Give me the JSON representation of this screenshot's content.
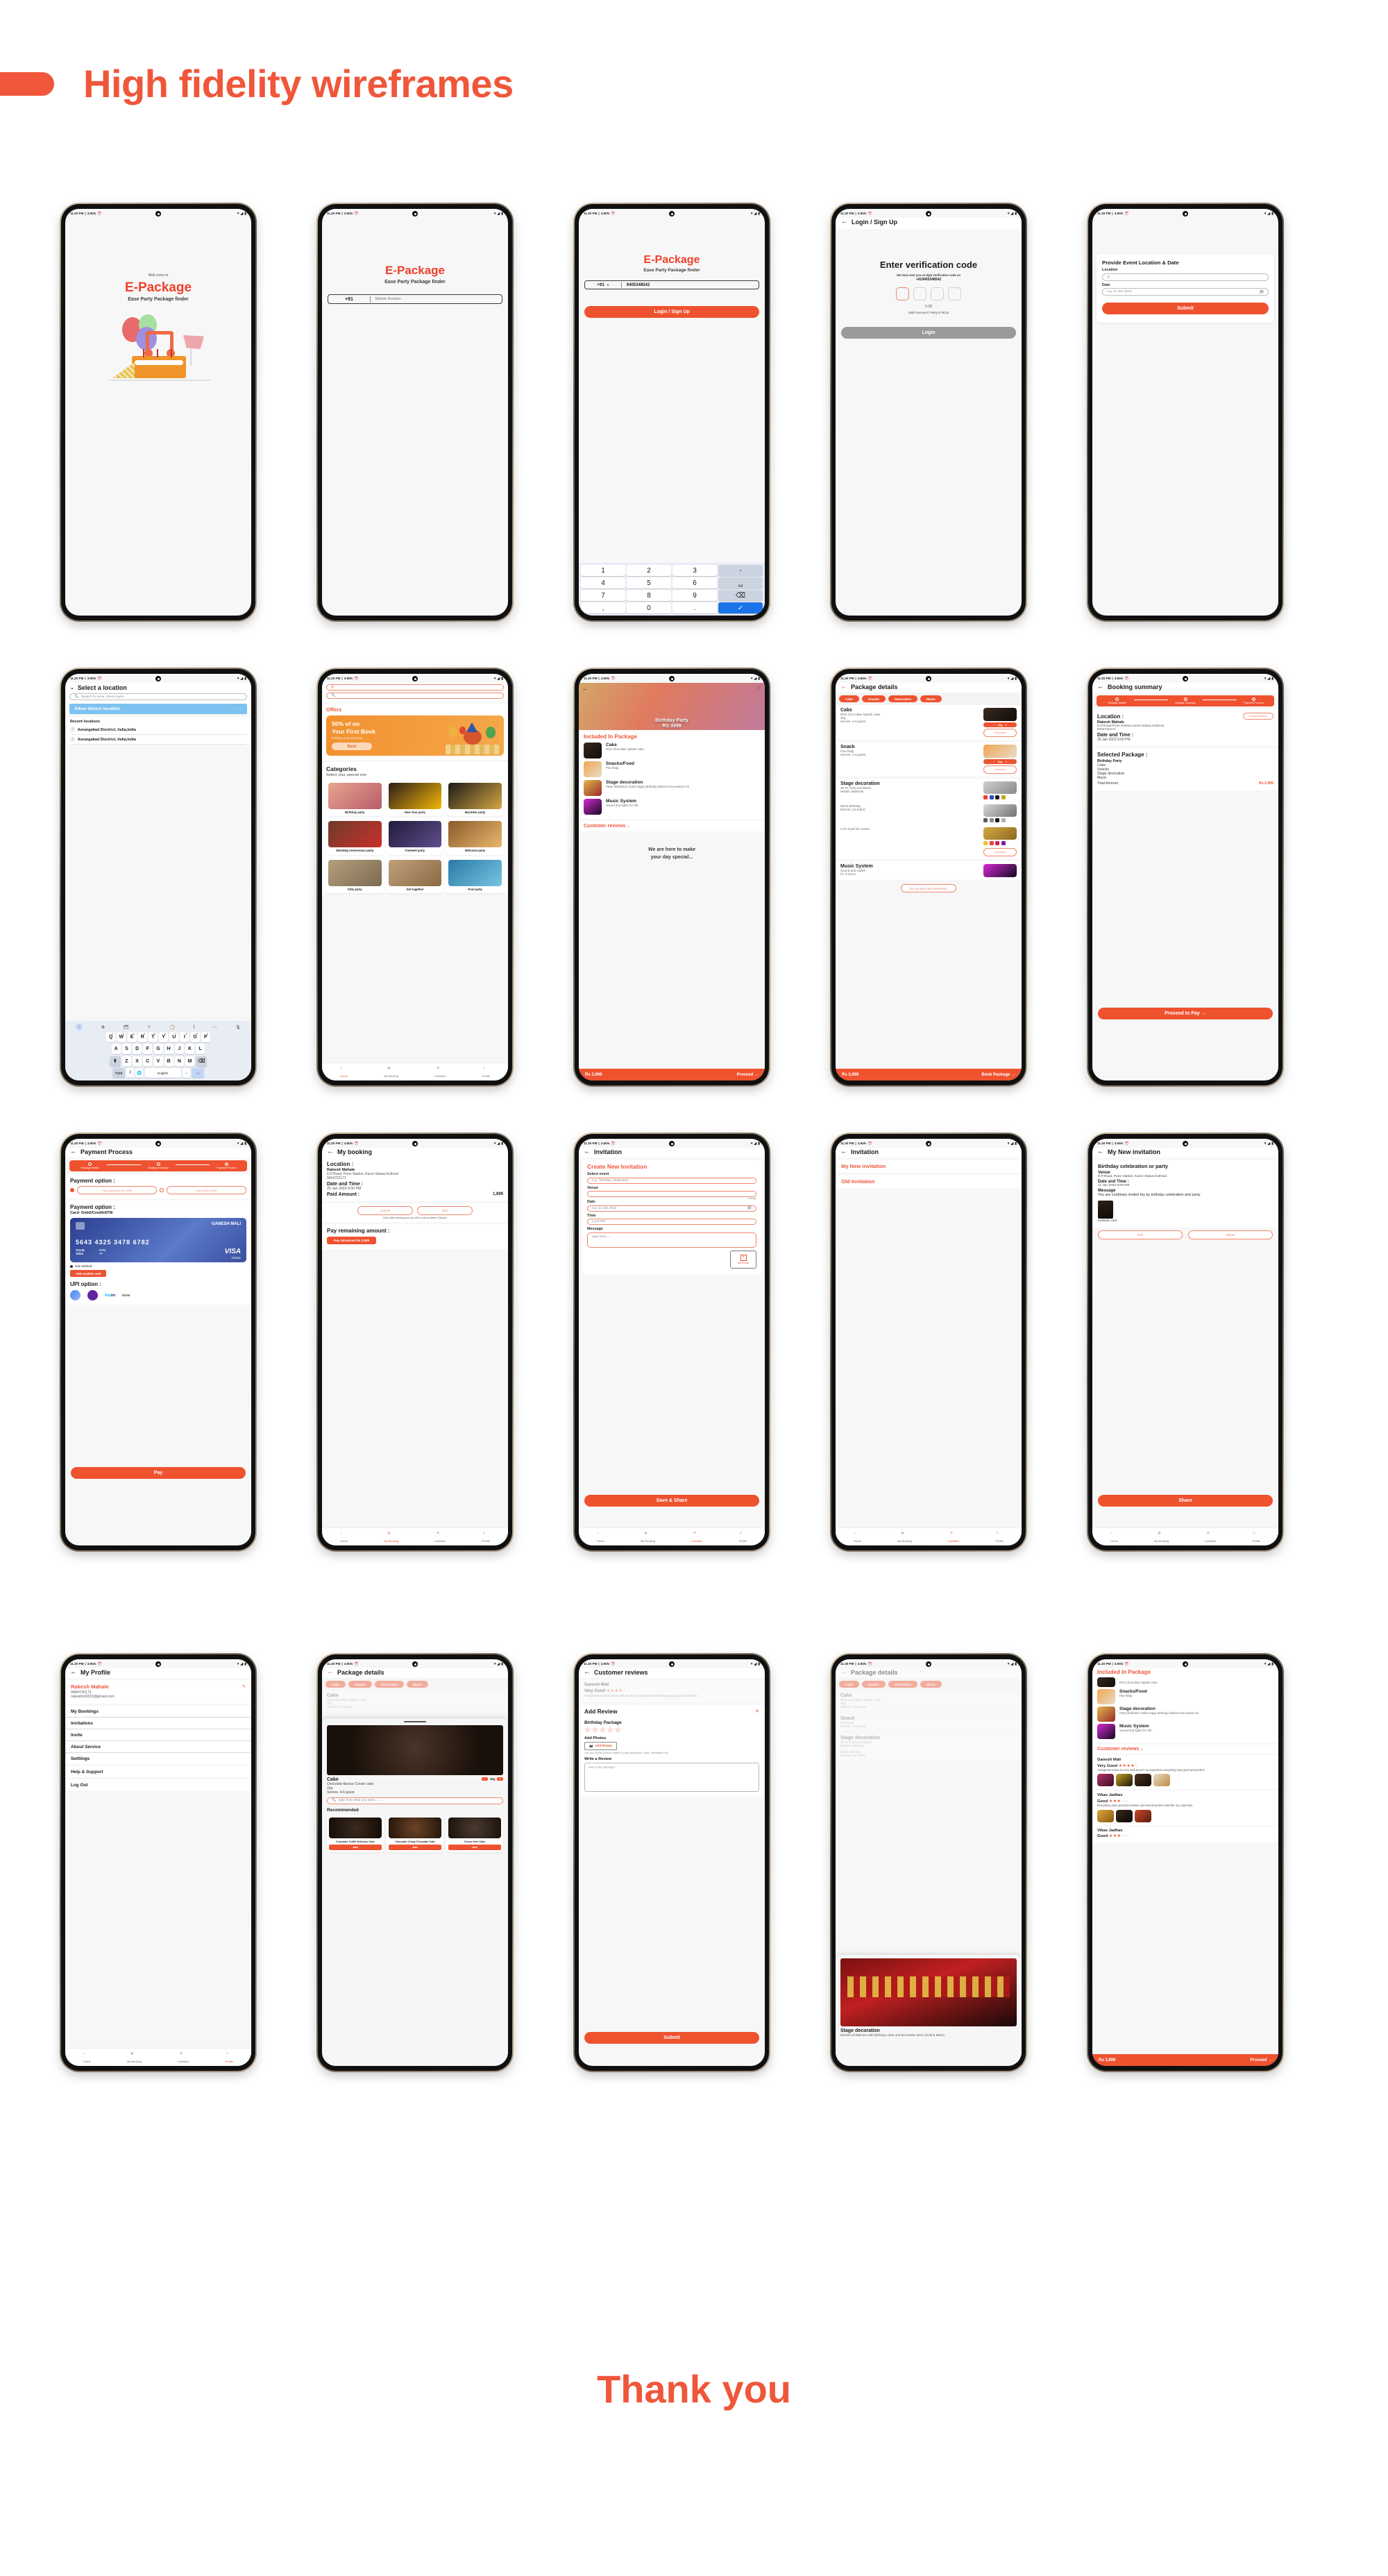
{
  "header": {
    "title": "High fidelity wireframes"
  },
  "footer": {
    "title": "Thank you"
  },
  "brand": {
    "accent": "#f0563a",
    "accent_dark": "#ef522f",
    "blue": "#1a73e8"
  },
  "status_bar": {
    "time": "11.20 PM",
    "net_speed": "3.90/s",
    "separator": "|"
  },
  "app": {
    "name": "E-Package",
    "tagline": "Ease Party Package finder",
    "welcome": "Well come to"
  },
  "screens": {
    "splash": {
      "welcome": "Well come to",
      "name": "E-Package",
      "tagline": "Ease Party Package finder"
    },
    "login_empty": {
      "name": "E-Package",
      "tagline": "Ease Party Package finder",
      "country_code": "+91",
      "mobile_placeholder": "Mobile Number"
    },
    "login_filled": {
      "name": "E-Package",
      "tagline": "Ease Party Package finder",
      "country_code": "+91",
      "mobile_value": "9405348542",
      "login_button": "Login / Sign Up",
      "keypad": [
        "1",
        "2",
        "3",
        "4",
        "5",
        "6",
        "7",
        "8",
        "9",
        ",",
        "0",
        "."
      ],
      "keypad_side": [
        "-",
        "␣",
        "⌫",
        "✓"
      ]
    },
    "otp": {
      "title": "Login / Sign Up",
      "heading": "Enter verification code",
      "subtext": "We have sent you o4 digit verification code on",
      "phone": "+919405348542",
      "timer": "0.28",
      "retry": "Didn't receive it? Retry in 00:22",
      "login_button": "Login"
    },
    "event_location": {
      "card_title": "Provide Event Location & Date",
      "location_label": "Location",
      "location_placeholder": "",
      "date_label": "Date",
      "date_placeholder": "e.g. 11 Jan 2023",
      "submit_button": "Submit"
    },
    "select_location": {
      "title": "Select a location",
      "search_placeholder": "Search for area, street name...",
      "allow_device_location": "Allow device location",
      "recent_label": "Recent locations",
      "recent": [
        "Aurangabad Disctrict, India,India",
        "Aurangabad Disctrict, India,India"
      ],
      "keyboard": {
        "row1": [
          "Q",
          "W",
          "E",
          "R",
          "T",
          "Y",
          "U",
          "I",
          "O",
          "P"
        ],
        "row1_nums": [
          "1",
          "2",
          "3",
          "4",
          "5",
          "6",
          "7",
          "8",
          "9",
          "0"
        ],
        "row2": [
          "A",
          "S",
          "D",
          "F",
          "G",
          "H",
          "J",
          "K",
          "L"
        ],
        "row3": [
          "Z",
          "X",
          "C",
          "V",
          "B",
          "N",
          "M"
        ],
        "num_key": "?123",
        "slash_key": "/",
        "space_label": "English",
        "period_key": ".",
        "enter_key": "→",
        "shift_key": "⬆",
        "backspace_key": "⌫"
      }
    },
    "home": {
      "location_placeholder": "",
      "search_placeholder": "",
      "offers_title": "Offers",
      "offer": {
        "line1": "50% of on",
        "line2": "Your First Book",
        "line3": "birthday party package",
        "button": "Book"
      },
      "categories_title": "Categories",
      "categories_sub": "Select your special one",
      "categories": [
        {
          "label": "Birthday party",
          "c1": "#e8a48f",
          "c2": "#b85c6a"
        },
        {
          "label": "New Year party",
          "c1": "#2b1d1a",
          "c2": "#f2b705"
        },
        {
          "label": "Bachelor party",
          "c1": "#1d1a16",
          "c2": "#d4a843"
        },
        {
          "label": "Wending Anniversary party",
          "c1": "#6d3b2a",
          "c2": "#c9302c"
        },
        {
          "label": "Farewell party",
          "c1": "#221b3a",
          "c2": "#5e4e8c"
        },
        {
          "label": "Welcome party",
          "c1": "#8a5a2b",
          "c2": "#e8b86d"
        },
        {
          "label": "Kitty party",
          "c1": "#b4a07d",
          "c2": "#7c6a52"
        },
        {
          "label": "Get together",
          "c1": "#c1a17a",
          "c2": "#8a6a45"
        },
        {
          "label": "Pool party",
          "c1": "#2a7aa8",
          "c2": "#77c4e0"
        }
      ],
      "nav": [
        "Home",
        "My Booking",
        "Invitation",
        "Profile"
      ]
    },
    "package_overview": {
      "hero_title": "Birthday Party",
      "hero_price": "RS 3999",
      "included_title": "Included In Package",
      "items": [
        {
          "name": "Cake",
          "desc": "Rich Chocolate Splash cake",
          "c1": "#3a2a20",
          "c2": "#0f0b08"
        },
        {
          "name": "Snacks/Food",
          "desc": "Pav-bhaji",
          "c1": "#f0a552",
          "c2": "#e8dcc8"
        },
        {
          "name": "Stage decoration",
          "desc": "Party Midlinkerz Solid Happy Birthday balloons Decoration Kit",
          "c1": "#e0b84a",
          "c2": "#9a2b2b"
        },
        {
          "name": "Music System",
          "desc": "Sound and lights for 3hr",
          "c1": "#d62ad6",
          "c2": "#140a1e"
        }
      ],
      "reviews_title": "Customer reviews",
      "tagline_1": "We are here to make",
      "tagline_2": "your day special...",
      "price": "Rs 3,999",
      "cta": "Proceed →"
    },
    "package_details": {
      "title": "Package details",
      "tabs": [
        "Cake",
        "Snacks",
        "Decoration",
        "Music"
      ],
      "sections": [
        {
          "name": "Cake",
          "lines": [
            "Rich Chocolate Splash cake",
            "1kg",
            "Serves- 4-6 guest"
          ],
          "stepper": "1kg",
          "customize": "Customize",
          "c1": "#3a2a20",
          "c2": "#0f0b08"
        },
        {
          "name": "Snack",
          "lines": [
            "Pav-bhaji",
            "Serves- 4-6 guest"
          ],
          "stepper": "1kg",
          "customize": "Customize",
          "c1": "#f0a552",
          "c2": "#e8dcc8"
        },
        {
          "name": "Stage decoration",
          "lines": [
            "30 Pc Gold and Black",
            "Metalic Balloons"
          ],
          "swatches": [
            "#ef4136",
            "#2d4bbf",
            "#1c1c1c",
            "#c9a227"
          ],
          "c1": "#cfcfcf",
          "c2": "#8a8a8a"
        },
        {
          "name": "",
          "lines": [
            "Black Birthday",
            "Banner (13 letter)"
          ],
          "swatches": [
            "#5c5c5c",
            "#8a8a8a",
            "#1c1c1c",
            "#b0b0b0"
          ],
          "c1": "#d9d9d9",
          "c2": "#707070"
        },
        {
          "name": "",
          "lines": [
            "2 Pc Gold foil curtain"
          ],
          "swatches": [
            "#f2c230",
            "#ef4136",
            "#d81b60",
            "#7b1fa2"
          ],
          "customize": "Customize",
          "c1": "#d4a843",
          "c2": "#8a6a20"
        },
        {
          "name": "Music System",
          "lines": [
            "Sound and Lights",
            "for 3 hours"
          ],
          "c1": "#d62ad6",
          "c2": "#140a1e"
        }
      ],
      "add_something": "Do you want add something?",
      "price": "Rs 3,999",
      "cta": "Book Package →"
    },
    "booking_summary": {
      "title": "Booking summary",
      "steps": [
        "Package Details",
        "Booking Summary",
        "Payment Process"
      ],
      "location_label": "Location :",
      "change_address": "Change address",
      "customer_name": "Rakesh Mahale",
      "address": "D.P.Road,Pune Station,Karve Statue,Kothrud",
      "phone": "9404720171",
      "datetime_label": "Date and Time :",
      "datetime": "25 Jan 2023   9:00 PM",
      "package_label": "Selected Package :",
      "package_items": [
        "Birthday Party",
        "Cake",
        "Snacks",
        "Stage decoration",
        "Music"
      ],
      "total_label": "Total Amount",
      "total_value": "Rs.3,999",
      "cta": "Proceed to Pay →"
    },
    "payment": {
      "title": "Payment Process",
      "steps": [
        "Package Details",
        "Booking Summary",
        "Payment Process"
      ],
      "option_label_1": "Payment option :",
      "pay_advanced": "Pay Advanced Rs 1,999",
      "pay_full": "Pay full Rs 3,999",
      "option_label_2": "Payment option :",
      "card_type": "Card- Debit/Credit/ATM",
      "card": {
        "holder": "GANESH MALI",
        "number": "5643  4325  3478  6782",
        "valid_label": "VALID",
        "valid_value": "10/24",
        "cvv_label": "CVV",
        "cvv_value": "•••",
        "brand": "VISA",
        "brand_sub": "Classic"
      },
      "use_default": "Use Default",
      "add_card": "Add another card",
      "upi_label": "UPI option :",
      "upi": [
        "GPay",
        "PhonePe",
        "Paytm",
        "BHIM"
      ],
      "pay_button": "Pay"
    },
    "my_booking": {
      "title": "My booking",
      "location_label": "Location :",
      "customer_name": "Rakesh Mahale",
      "address": "D.P.Road, Pune Station, Karve Statue,Kothrud",
      "phone": "9404720171",
      "datetime_label": "Date and Time :",
      "datetime": "25 Jan 2023   9:00 PM",
      "paid_label": "Paid Amount :",
      "paid_value": "1,999",
      "cancel_button": "Cancel",
      "edit_button": "Edit",
      "note": "Note- After booking you con edit or cancel witthin 24hours",
      "remaining_label": "Pay remaining amount :",
      "remaining_button": "Pay Advanced Rs 2,000",
      "nav": [
        "Home",
        "My Booking",
        "Invitation",
        "Profile"
      ]
    },
    "invitation_create": {
      "title": "Invitation",
      "heading": "Create New Invitation",
      "fields": [
        {
          "label": "Select event",
          "placeholder": "e.g . birthday celebration"
        },
        {
          "label": "Venue",
          "placeholder": ""
        },
        {
          "label": "Date",
          "placeholder": "e.g. 11 Jan 2023"
        },
        {
          "label": "Time",
          "placeholder": "e.g  9 PM"
        },
        {
          "label": "Message",
          "placeholder": "type here......"
        }
      ],
      "change_link": "Change",
      "add_picture": "Add Picture",
      "save_button": "Save & Share",
      "nav": [
        "Home",
        "My Booking",
        "Invitation",
        "Profile"
      ]
    },
    "invitation_list": {
      "title": "Invitation",
      "items": [
        "My New invitation",
        "Old Invitation"
      ],
      "nav": [
        "Home",
        "My Booking",
        "Invitation",
        "Profile"
      ]
    },
    "invitation_detail": {
      "title": "My New invitation",
      "event": "Birthday celebration or party",
      "venue_label": "Venue",
      "venue": "D.P.Road, Pune Station, Karve Statue,Kothrud",
      "datetime_label": "Date and Time :",
      "datetime": "11 Jan 2023   9:00 PM",
      "message_label": "Message",
      "message": "You are cordinary invited foy by birthday celebration and party",
      "card_caption": "Invitation card",
      "edit_button": "Edit",
      "delete_button": "Delete",
      "share_button": "Share",
      "nav": [
        "Home",
        "My Booking",
        "Invitation",
        "Profile"
      ]
    },
    "profile": {
      "title": "My Profile",
      "name": "Rakesh Mahale",
      "phone": "9404720171",
      "email": "rakeshm0222@gmail.com",
      "menu": [
        "My Bookings",
        "Invitations",
        "Invite",
        "About Service",
        "Setttings",
        "Help & Support",
        "Log Out"
      ],
      "nav": [
        "Home",
        "My Booking",
        "Invitation",
        "Profile"
      ]
    },
    "cake_customize": {
      "title": "Package details",
      "tabs": [
        "Cake",
        "Snacks",
        "Decoration",
        "Music"
      ],
      "bg_section": {
        "name": "Cake",
        "lines": [
          "Rich Chocolate Splash cake",
          "1kg",
          "Serves- 4-6 guest"
        ]
      },
      "sheet": {
        "name": "Cake",
        "desc": "Chocolate flavour-Cream cake",
        "weight": "1kg",
        "serves": "Serves- 4-6 guest",
        "stepper": "1kg",
        "search_placeholder": "type here what you want.........",
        "recommended_title": "Recommended",
        "recommended": [
          {
            "name": "Chocolate Truffle Delicious Cake",
            "button": "Add"
          },
          {
            "name": "Chocolate Crispy Chocolate Cake",
            "button": "Add"
          },
          {
            "name": "Choco Oreo Cake",
            "button": "Add"
          }
        ]
      }
    },
    "add_review": {
      "title": "Customer reviews",
      "existing": {
        "name": "Ganesh Mali",
        "rating_label": "Very Good",
        "stars": 4,
        "text": "Arangement was so very well as per my expection everything was good and perfect"
      },
      "modal_title": "Add Review",
      "package_label": "Birthday Package",
      "stars": 0,
      "add_photos_label": "Add Photos",
      "add_photos_button": "Add Photos",
      "photos_hint": "You can upload photos related to party decoration, cake, celebration etc.",
      "write_label": "Write a Review",
      "write_placeholder": "How is the package?",
      "submit_button": "Submit"
    },
    "decoration_detail": {
      "title": "Package details",
      "tabs": [
        "Cake",
        "Snacks",
        "Decoration",
        "Music"
      ],
      "sections": [
        {
          "name": "Cake",
          "lines": [
            "Rich Chocolate Splash cake",
            "1kg",
            "Serves- 4-6 guest"
          ]
        },
        {
          "name": "Snack",
          "lines": [
            "Pav-bhaji",
            "Serves- 4-6 guest"
          ]
        },
        {
          "name": "Stage decoration",
          "lines": [
            "30 Pc Gold and Black",
            "Metalic Balloons"
          ]
        },
        {
          "name": "",
          "lines": [
            "Black Birthday",
            "Banner (13 letter)"
          ]
        }
      ],
      "sheet": {
        "name": "Stage decoration",
        "desc": "Metalic foil Balloons with Birthday Letter and Decoration items (Gold & Black)"
      }
    },
    "package_reviews": {
      "included_title": "Included In Package",
      "items": [
        {
          "name": "",
          "desc": "Rich Chocolate Splash cake",
          "c1": "#3a2a20",
          "c2": "#0f0b08"
        },
        {
          "name": "Snacks/Food",
          "desc": "Pav-bhaji",
          "c1": "#f0a552",
          "c2": "#e8dcc8"
        },
        {
          "name": "Stage decoration",
          "desc": "Party Midlinkerz Solid Happy Birthday balloons Decoration Kit",
          "c1": "#e0b84a",
          "c2": "#9a2b2b"
        },
        {
          "name": "Music System",
          "desc": "Sound and lights for 3hr",
          "c1": "#d62ad6",
          "c2": "#140a1e"
        }
      ],
      "reviews_title": "Customer reviews",
      "reviews": [
        {
          "name": "Ganesh Mali",
          "rating_label": "Very Good",
          "stars": 4,
          "text": "Arangement was so very well as per my expection everything was good and perfect",
          "photos": [
            "#b0306a",
            "#c9a227",
            "#3a2a20",
            "#e8dcc8"
          ]
        },
        {
          "name": "Vikas Jadhav",
          "rating_label": "Good",
          "stars": 3,
          "text": "Everything was good.Decoration and sound system was like my expection.",
          "photos": [
            "#e0a43a",
            "#201a16",
            "#c94a2a"
          ]
        },
        {
          "name": "Vikas Jadhav",
          "rating_label": "Good",
          "stars": 3,
          "text": "",
          "photos": []
        }
      ],
      "price": "Rs 3,999",
      "cta": "Proceed →"
    }
  }
}
